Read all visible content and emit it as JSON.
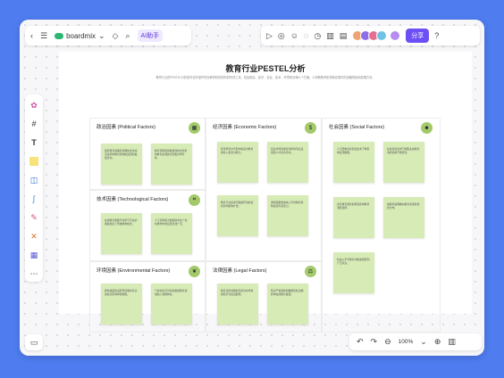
{
  "app": {
    "brand": "boardmix",
    "ai_label": "AI助手",
    "share_label": "分享"
  },
  "board": {
    "title": "教育行业PESTEL分析",
    "subtitle": "教育行业的PESTEL分析是评估外部环境对教育机构影响的有效工具，包括政治、经济、社会、技术、环境和法律六个方面，以帮助教育机构制定更好的战略规划和发展方向。",
    "sections": [
      {
        "title": "政治因素 (Political Factors)",
        "notes": [
          "政府教育政策和法规的变化将直接影响教育机构的运营和发展方向。",
          "教育预算和财政拨款的变化影响教育资源的分配和办学条件。"
        ]
      },
      {
        "title": "技术因素 (Technological Factors)",
        "notes": [
          "在线教育和数字化学习平台的发展改变了传统教学模式。",
          "人工智能和大数据技术在个性化教学中的应用日益广泛。"
        ]
      },
      {
        "title": "环境因素 (Environmental Factors)",
        "notes": [
          "绿色校园建设和环境保护意识的提高影响学校规划。",
          "气候变化与可持续发展教育逐渐纳入课程体系。"
        ]
      },
      {
        "title": "经济因素 (Economic Factors)",
        "notes": [
          "经济增长水平影响家庭对教育的投入和支付能力。",
          "就业市场需求变化影响专业设置和人才培养方向。",
          "教育行业投资与融资环境的变化影响机构扩张。",
          "通货膨胀和成本上升对教育机构运营带来压力。"
        ]
      },
      {
        "title": "法律因素 (Legal Factors)",
        "notes": [
          "教育法律法规的完善对办学资质和行为提出要求。",
          "知识产权保护和数据隐私法规影响在线教育发展。"
        ]
      },
      {
        "title": "社会因素 (Social Factors)",
        "notes": [
          "人口结构变化和出生率下降影响生源数量。",
          "社会对终身学习和职业技能培训的需求不断增长。",
          "家长教育观念的转变影响教育消费选择。",
          "城镇化进程推动教育资源的重新分布。",
          "社会公平与教育均衡发展受到广泛关注。"
        ]
      }
    ]
  },
  "zoom": {
    "level": "100%"
  },
  "colors": {
    "note": "#d7ebb6",
    "icon_bg": "#a3c96a",
    "share": "#6d4ff5",
    "background": "#4f7df0"
  }
}
